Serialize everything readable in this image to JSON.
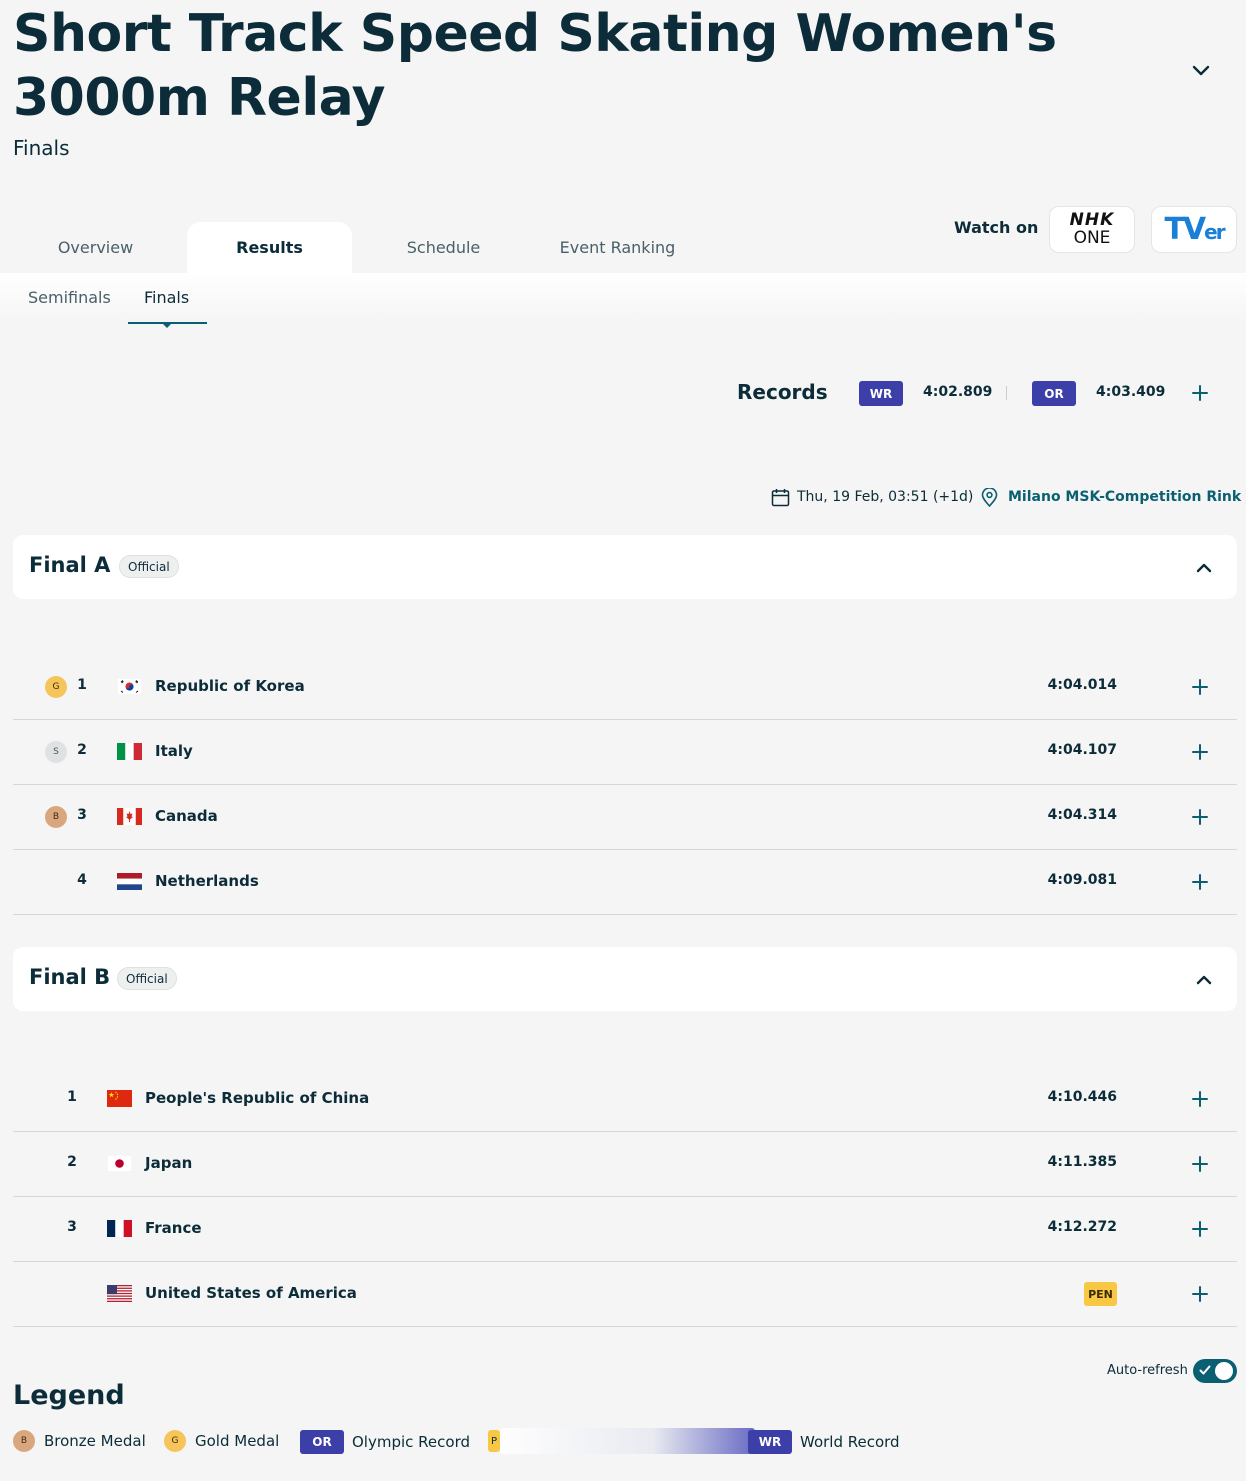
{
  "header": {
    "title": "Short Track Speed Skating Women's 3000m Relay",
    "subtitle": "Finals"
  },
  "tabs": [
    "Overview",
    "Results",
    "Schedule",
    "Event Ranking"
  ],
  "watch": {
    "label": "Watch on",
    "nhk_line1": "NHK",
    "nhk_line2": "ONE",
    "tver_main": "TV",
    "tver_small": "er"
  },
  "subtabs": [
    "Semifinals",
    "Finals"
  ],
  "records": {
    "label": "Records",
    "wr_badge": "WR",
    "wr_value": "4:02.809",
    "or_badge": "OR",
    "or_value": "4:03.409"
  },
  "meta": {
    "date": "Thu, 19 Feb, 03:51 (+1d)",
    "location": "Milano MSK-Competition Rink"
  },
  "final_a": {
    "title": "Final A",
    "status": "Official",
    "rows": [
      {
        "medal": "G",
        "rank": "1",
        "country": "Republic of Korea",
        "time": "4:04.014"
      },
      {
        "medal": "S",
        "rank": "2",
        "country": "Italy",
        "time": "4:04.107"
      },
      {
        "medal": "B",
        "rank": "3",
        "country": "Canada",
        "time": "4:04.314"
      },
      {
        "medal": "",
        "rank": "4",
        "country": "Netherlands",
        "time": "4:09.081"
      }
    ]
  },
  "final_b": {
    "title": "Final B",
    "status": "Official",
    "rows": [
      {
        "rank": "1",
        "country": "People's Republic of China",
        "time": "4:10.446"
      },
      {
        "rank": "2",
        "country": "Japan",
        "time": "4:11.385"
      },
      {
        "rank": "3",
        "country": "France",
        "time": "4:12.272"
      },
      {
        "rank": "",
        "country": "United States of America",
        "time": "",
        "badge": "PEN"
      }
    ]
  },
  "auto_refresh": {
    "label": "Auto-refresh",
    "enabled": true
  },
  "legend": {
    "title": "Legend",
    "items": [
      {
        "symbol": "B",
        "label": "Bronze Medal"
      },
      {
        "symbol": "G",
        "label": "Gold Medal"
      },
      {
        "symbol": "OR",
        "label": "Olympic Record"
      },
      {
        "symbol": "P",
        "label": ""
      },
      {
        "symbol": "WR",
        "label": "World Record"
      }
    ]
  },
  "colors": {
    "primary": "#0b2c38",
    "accent": "#0b5f73",
    "record_badge": "#3c3fa8",
    "gold": "#f5c55b",
    "silver": "#dfe2e3",
    "bronze": "#d9a77d",
    "pen_badge": "#f8c845"
  },
  "icons": {
    "expand": "chevron-down-icon",
    "collapse": "chevron-up-icon",
    "add": "plus-icon",
    "calendar": "calendar-icon",
    "location": "location-pin-icon"
  }
}
